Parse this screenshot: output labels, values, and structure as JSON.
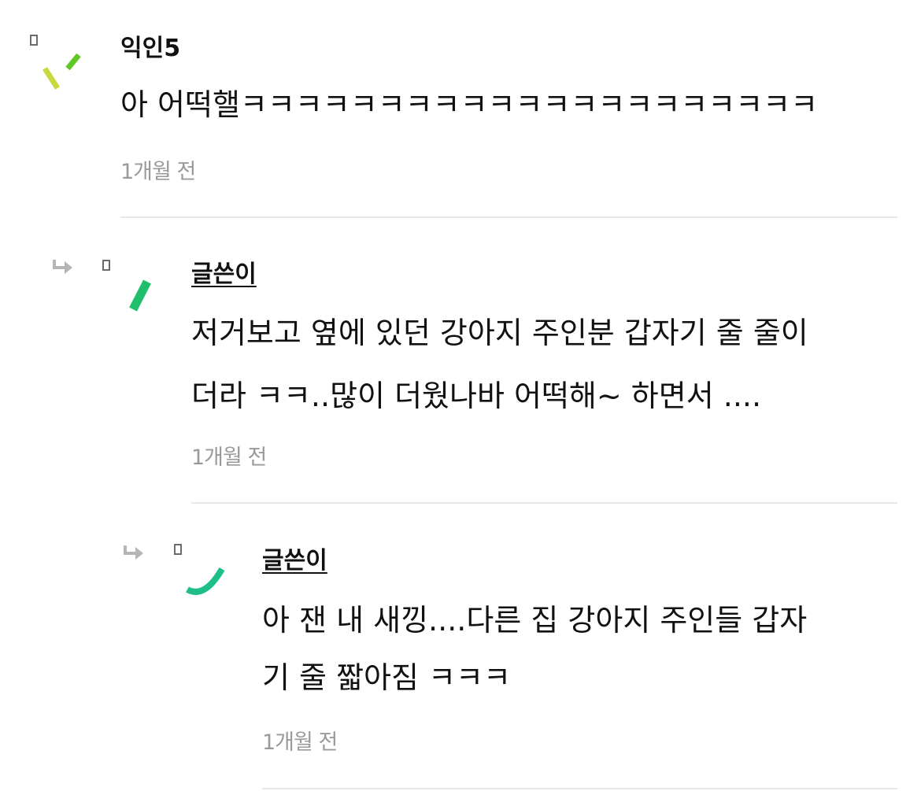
{
  "comments": [
    {
      "author": "익인5",
      "lines": [
        "아 어떡핼ㅋㅋㅋㅋㅋㅋㅋㅋㅋㅋㅋㅋㅋㅋㅋㅋㅋㅋㅋㅋㅋ"
      ],
      "time": "1개월 전",
      "avatar_icon": "confetti-avatar-icon",
      "colors": {
        "primary": "#5ec926",
        "secondary": "#c9d83e"
      }
    },
    {
      "author": "글쓴이",
      "lines": [
        "저거보고 옆에 있던 강아지 주인분 갑자기 줄 줄이",
        "더라 ㅋㅋ..많이 더웠나바 어떡해~ 하면서 ...."
      ],
      "time": "1개월 전",
      "avatar_icon": "slash-avatar-icon",
      "colors": {
        "primary": "#1fbf6b"
      }
    },
    {
      "author": "글쓴이",
      "lines": [
        "아 잰 내 새낑....다른 집 강아지 주인들 갑자",
        "기 줄 짧아짐 ㅋㅋㅋ"
      ],
      "time": "1개월 전",
      "avatar_icon": "arc-avatar-icon",
      "colors": {
        "primary": "#1dbf86"
      }
    }
  ],
  "colors": {
    "text": "#111111",
    "meta": "#9a9a9a",
    "divider": "#e8e8e8",
    "reply_arrow": "#b5b5b5"
  }
}
